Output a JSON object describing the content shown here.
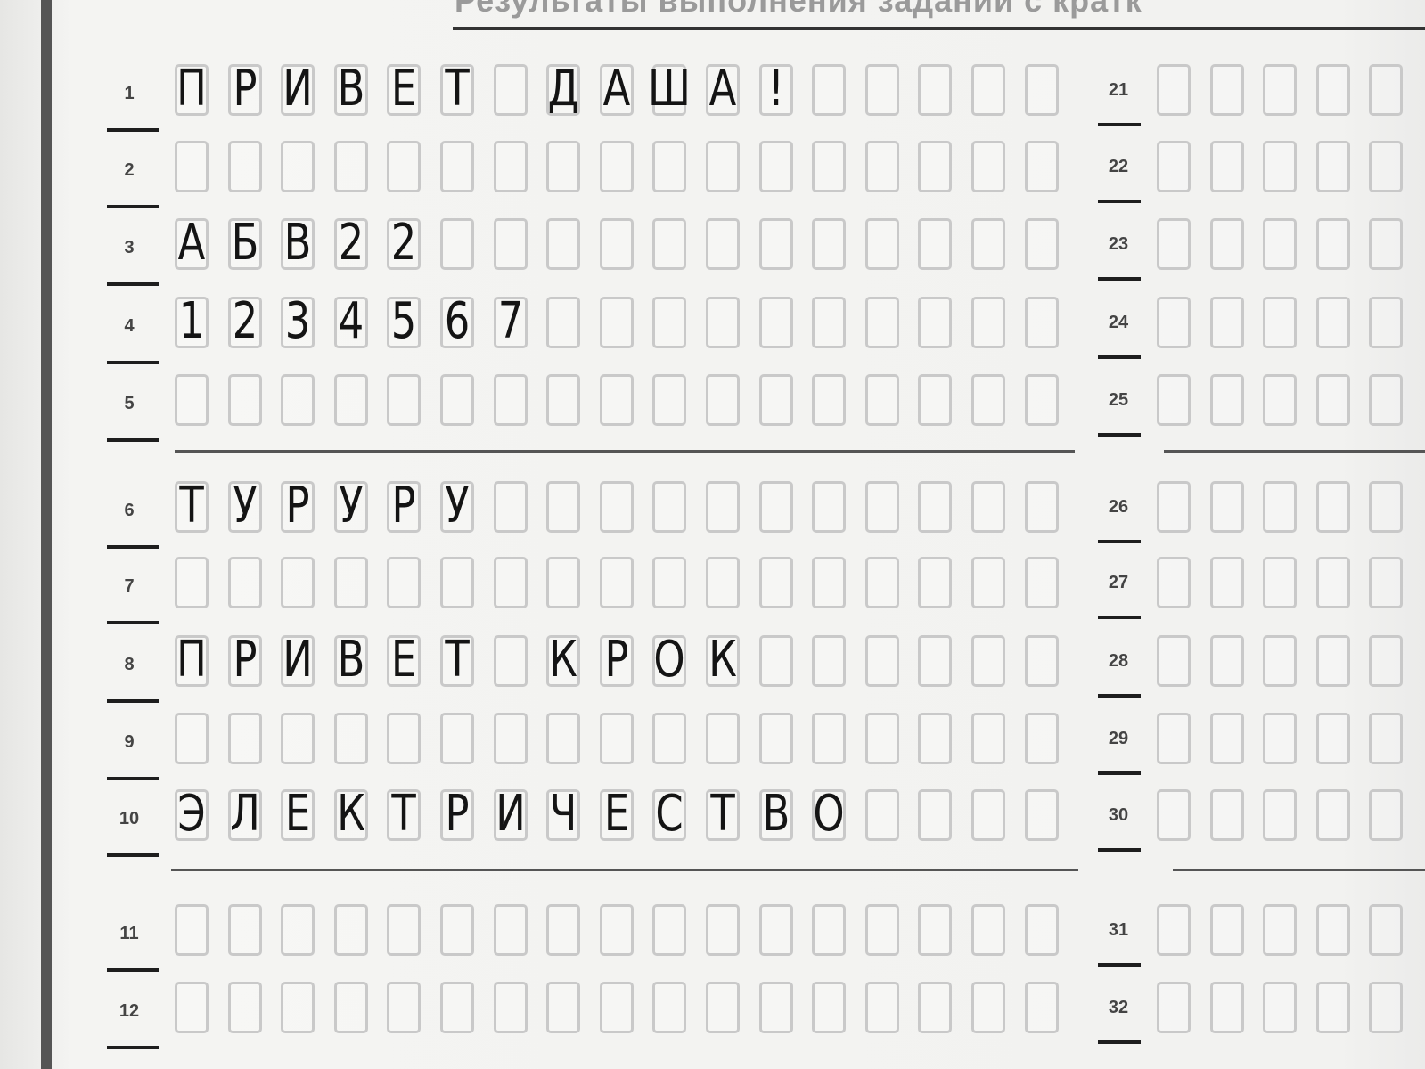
{
  "header": {
    "title": "Результаты выполнения заданий с кратк"
  },
  "left_rows": [
    {
      "num": "1",
      "answer": "ПРИВЕТ ДАША!"
    },
    {
      "num": "2",
      "answer": ""
    },
    {
      "num": "3",
      "answer": "АБВ22"
    },
    {
      "num": "4",
      "answer": "1234567"
    },
    {
      "num": "5",
      "answer": ""
    },
    {
      "num": "6",
      "answer": "ТУРУРУ"
    },
    {
      "num": "7",
      "answer": ""
    },
    {
      "num": "8",
      "answer": "ПРИВЕТ КРОК"
    },
    {
      "num": "9",
      "answer": ""
    },
    {
      "num": "10",
      "answer": "ЭЛЕКТРИЧЕСТВО"
    },
    {
      "num": "11",
      "answer": ""
    },
    {
      "num": "12",
      "answer": ""
    }
  ],
  "right_rows": [
    {
      "num": "21"
    },
    {
      "num": "22"
    },
    {
      "num": "23"
    },
    {
      "num": "24"
    },
    {
      "num": "25"
    },
    {
      "num": "26"
    },
    {
      "num": "27"
    },
    {
      "num": "28"
    },
    {
      "num": "29"
    },
    {
      "num": "30"
    },
    {
      "num": "31"
    },
    {
      "num": "32"
    }
  ]
}
